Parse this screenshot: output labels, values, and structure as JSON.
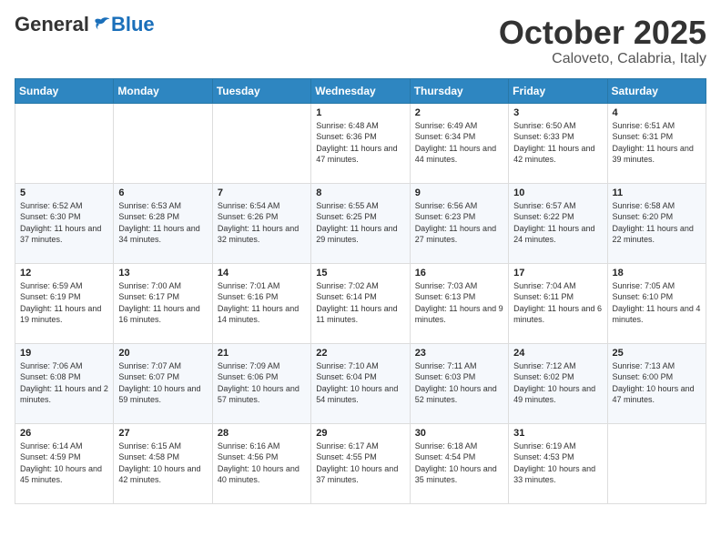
{
  "header": {
    "logo_general": "General",
    "logo_blue": "Blue",
    "month_title": "October 2025",
    "subtitle": "Caloveto, Calabria, Italy"
  },
  "weekdays": [
    "Sunday",
    "Monday",
    "Tuesday",
    "Wednesday",
    "Thursday",
    "Friday",
    "Saturday"
  ],
  "weeks": [
    [
      {
        "day": "",
        "info": ""
      },
      {
        "day": "",
        "info": ""
      },
      {
        "day": "",
        "info": ""
      },
      {
        "day": "1",
        "info": "Sunrise: 6:48 AM\nSunset: 6:36 PM\nDaylight: 11 hours and 47 minutes."
      },
      {
        "day": "2",
        "info": "Sunrise: 6:49 AM\nSunset: 6:34 PM\nDaylight: 11 hours and 44 minutes."
      },
      {
        "day": "3",
        "info": "Sunrise: 6:50 AM\nSunset: 6:33 PM\nDaylight: 11 hours and 42 minutes."
      },
      {
        "day": "4",
        "info": "Sunrise: 6:51 AM\nSunset: 6:31 PM\nDaylight: 11 hours and 39 minutes."
      }
    ],
    [
      {
        "day": "5",
        "info": "Sunrise: 6:52 AM\nSunset: 6:30 PM\nDaylight: 11 hours and 37 minutes."
      },
      {
        "day": "6",
        "info": "Sunrise: 6:53 AM\nSunset: 6:28 PM\nDaylight: 11 hours and 34 minutes."
      },
      {
        "day": "7",
        "info": "Sunrise: 6:54 AM\nSunset: 6:26 PM\nDaylight: 11 hours and 32 minutes."
      },
      {
        "day": "8",
        "info": "Sunrise: 6:55 AM\nSunset: 6:25 PM\nDaylight: 11 hours and 29 minutes."
      },
      {
        "day": "9",
        "info": "Sunrise: 6:56 AM\nSunset: 6:23 PM\nDaylight: 11 hours and 27 minutes."
      },
      {
        "day": "10",
        "info": "Sunrise: 6:57 AM\nSunset: 6:22 PM\nDaylight: 11 hours and 24 minutes."
      },
      {
        "day": "11",
        "info": "Sunrise: 6:58 AM\nSunset: 6:20 PM\nDaylight: 11 hours and 22 minutes."
      }
    ],
    [
      {
        "day": "12",
        "info": "Sunrise: 6:59 AM\nSunset: 6:19 PM\nDaylight: 11 hours and 19 minutes."
      },
      {
        "day": "13",
        "info": "Sunrise: 7:00 AM\nSunset: 6:17 PM\nDaylight: 11 hours and 16 minutes."
      },
      {
        "day": "14",
        "info": "Sunrise: 7:01 AM\nSunset: 6:16 PM\nDaylight: 11 hours and 14 minutes."
      },
      {
        "day": "15",
        "info": "Sunrise: 7:02 AM\nSunset: 6:14 PM\nDaylight: 11 hours and 11 minutes."
      },
      {
        "day": "16",
        "info": "Sunrise: 7:03 AM\nSunset: 6:13 PM\nDaylight: 11 hours and 9 minutes."
      },
      {
        "day": "17",
        "info": "Sunrise: 7:04 AM\nSunset: 6:11 PM\nDaylight: 11 hours and 6 minutes."
      },
      {
        "day": "18",
        "info": "Sunrise: 7:05 AM\nSunset: 6:10 PM\nDaylight: 11 hours and 4 minutes."
      }
    ],
    [
      {
        "day": "19",
        "info": "Sunrise: 7:06 AM\nSunset: 6:08 PM\nDaylight: 11 hours and 2 minutes."
      },
      {
        "day": "20",
        "info": "Sunrise: 7:07 AM\nSunset: 6:07 PM\nDaylight: 10 hours and 59 minutes."
      },
      {
        "day": "21",
        "info": "Sunrise: 7:09 AM\nSunset: 6:06 PM\nDaylight: 10 hours and 57 minutes."
      },
      {
        "day": "22",
        "info": "Sunrise: 7:10 AM\nSunset: 6:04 PM\nDaylight: 10 hours and 54 minutes."
      },
      {
        "day": "23",
        "info": "Sunrise: 7:11 AM\nSunset: 6:03 PM\nDaylight: 10 hours and 52 minutes."
      },
      {
        "day": "24",
        "info": "Sunrise: 7:12 AM\nSunset: 6:02 PM\nDaylight: 10 hours and 49 minutes."
      },
      {
        "day": "25",
        "info": "Sunrise: 7:13 AM\nSunset: 6:00 PM\nDaylight: 10 hours and 47 minutes."
      }
    ],
    [
      {
        "day": "26",
        "info": "Sunrise: 6:14 AM\nSunset: 4:59 PM\nDaylight: 10 hours and 45 minutes."
      },
      {
        "day": "27",
        "info": "Sunrise: 6:15 AM\nSunset: 4:58 PM\nDaylight: 10 hours and 42 minutes."
      },
      {
        "day": "28",
        "info": "Sunrise: 6:16 AM\nSunset: 4:56 PM\nDaylight: 10 hours and 40 minutes."
      },
      {
        "day": "29",
        "info": "Sunrise: 6:17 AM\nSunset: 4:55 PM\nDaylight: 10 hours and 37 minutes."
      },
      {
        "day": "30",
        "info": "Sunrise: 6:18 AM\nSunset: 4:54 PM\nDaylight: 10 hours and 35 minutes."
      },
      {
        "day": "31",
        "info": "Sunrise: 6:19 AM\nSunset: 4:53 PM\nDaylight: 10 hours and 33 minutes."
      },
      {
        "day": "",
        "info": ""
      }
    ]
  ]
}
